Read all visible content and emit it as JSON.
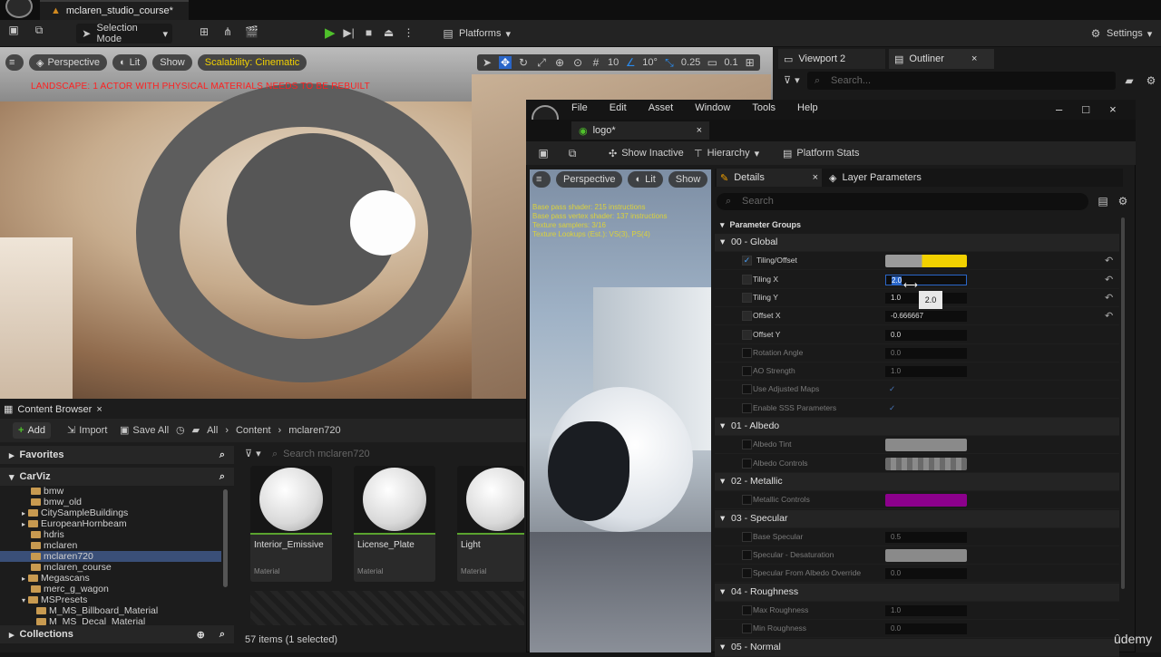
{
  "window": {
    "tab_title": "mclaren_studio_course*"
  },
  "toolbar": {
    "selection_mode": "Selection Mode",
    "platforms": "Platforms",
    "settings": "Settings"
  },
  "viewport": {
    "perspective": "Perspective",
    "lit": "Lit",
    "show": "Show",
    "scalability": "Scalability: Cinematic",
    "warning": "LANDSCAPE: 1 ACTOR WITH PHYSICAL MATERIALS NEEDS TO BE REBUILT",
    "snap": {
      "grid": "10",
      "rotation": "10°",
      "scale": "0.25",
      "camera": "0.1"
    }
  },
  "right_panel": {
    "viewport2_tab": "Viewport 2",
    "outliner_tab": "Outliner",
    "search_placeholder": "Search..."
  },
  "content_browser": {
    "tab": "Content Browser",
    "add": "Add",
    "import": "Import",
    "save_all": "Save All",
    "breadcrumb": [
      "All",
      "Content",
      "mclaren720"
    ],
    "favorites": "Favorites",
    "root": "CarViz",
    "search_placeholder": "Search mclaren720",
    "tree": [
      "bmw",
      "bmw_old",
      "CitySampleBuildings",
      "EuropeanHornbeam",
      "hdris",
      "mclaren",
      "mclaren720",
      "mclaren_course",
      "Megascans",
      "merc_g_wagon",
      "MSPresets",
      "M_MS_Billboard_Material",
      "M_MS_Decal_Material"
    ],
    "collections": "Collections",
    "assets": [
      {
        "name": "Interior_Emissive",
        "type": "Material"
      },
      {
        "name": "License_Plate",
        "type": "Material"
      },
      {
        "name": "Light",
        "type": "Material"
      }
    ],
    "items_count": "57 items (1 selected)"
  },
  "material_editor": {
    "menu": [
      "File",
      "Edit",
      "Asset",
      "Window",
      "Tools",
      "Help"
    ],
    "tab": "logo*",
    "tools": {
      "show_inactive": "Show Inactive",
      "hierarchy": "Hierarchy",
      "platform_stats": "Platform Stats"
    },
    "preview": {
      "perspective": "Perspective",
      "lit": "Lit",
      "show": "Show"
    },
    "stats": [
      "Base pass shader: 215 instructions",
      "Base pass vertex shader: 137 instructions",
      "Texture samplers: 3/16",
      "Texture Lookups (Est.): VS(3), PS(4)"
    ],
    "details_tab": "Details",
    "layer_tab": "Layer Parameters",
    "search_placeholder": "Search",
    "param_groups": "Parameter Groups",
    "tooltip": "2.0",
    "rows": [
      {
        "label": "00 - Global",
        "group": true
      },
      {
        "label": "Tiling/Offset",
        "swatch": "yellow"
      },
      {
        "label": "Tiling X",
        "value": "2.0",
        "editing": true
      },
      {
        "label": "Tiling Y",
        "value": "1.0"
      },
      {
        "label": "Offset X",
        "value": "-0.666667"
      },
      {
        "label": "Offset Y",
        "value": "0.0"
      },
      {
        "label": "Rotation Angle",
        "value": "0.0",
        "dim": true
      },
      {
        "label": "AO Strength",
        "value": "1.0",
        "dim": true
      },
      {
        "label": "Use Adjusted Maps",
        "check": true,
        "dim": true
      },
      {
        "label": "Enable SSS Parameters",
        "check": true,
        "dim": true
      },
      {
        "label": "01 - Albedo",
        "group": true
      },
      {
        "label": "Albedo Tint",
        "swatch": "grey",
        "dim": true
      },
      {
        "label": "Albedo Controls",
        "swatch": "checker",
        "dim": true
      },
      {
        "label": "02 - Metallic",
        "group": true
      },
      {
        "label": "Metallic Controls",
        "swatch": "purple",
        "dim": true
      },
      {
        "label": "03 - Specular",
        "group": true
      },
      {
        "label": "Base Specular",
        "value": "0.5",
        "dim": true
      },
      {
        "label": "Specular - Desaturation",
        "swatch": "grey",
        "dim": true
      },
      {
        "label": "Specular From Albedo Override",
        "value": "0.0",
        "dim": true
      },
      {
        "label": "04 - Roughness",
        "group": true
      },
      {
        "label": "Max Roughness",
        "value": "1.0",
        "dim": true
      },
      {
        "label": "Min Roughness",
        "value": "0.0",
        "dim": true
      },
      {
        "label": "05 - Normal",
        "group": true
      }
    ],
    "colors": {
      "yellow": "#f2d100",
      "purple": "#8c008c",
      "grey": "#8a8a8a"
    }
  },
  "watermark": "ûdemy"
}
